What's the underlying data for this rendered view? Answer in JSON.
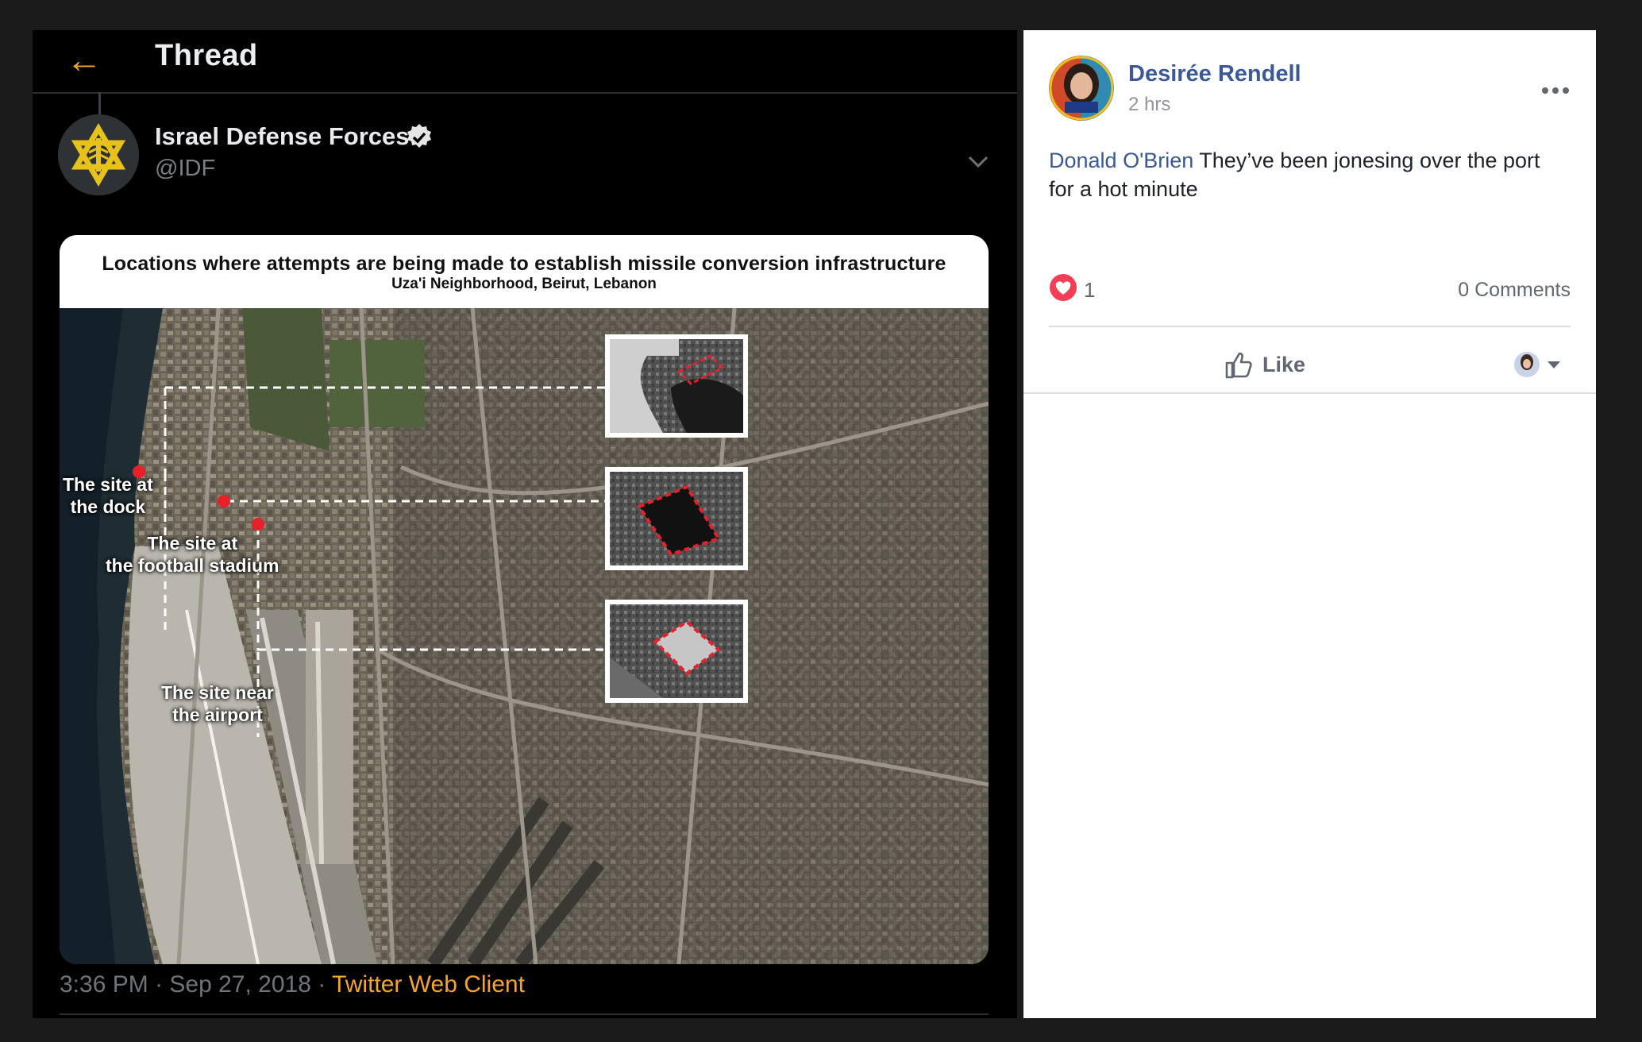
{
  "twitter": {
    "header": {
      "title": "Thread",
      "back_icon": "back-arrow-icon"
    },
    "tweet": {
      "author_name": "Israel Defense Forces",
      "handle": "@IDF",
      "verified": true,
      "media": {
        "title": "Locations where attempts are being made to establish missile conversion infrastructure",
        "subtitle": "Uza'i Neighborhood, Beirut, Lebanon",
        "labels": {
          "dock": "The site at\nthe dock",
          "stadium": "The site at\nthe football stadium",
          "airport": "The site near\nthe airport"
        }
      },
      "time": "3:36 PM",
      "separator": "·",
      "date": "Sep 27, 2018",
      "client": "Twitter Web Client"
    },
    "colors": {
      "accent": "#f4a52b",
      "background": "#000000"
    }
  },
  "facebook": {
    "post": {
      "author": "Desirée Rendell",
      "time": "2 hrs",
      "mention": "Donald O'Brien",
      "text": " They’ve been jonesing over the port for a hot minute",
      "reaction_count": "1",
      "comments": "0 Comments",
      "like_label": "Like"
    },
    "colors": {
      "link": "#3b5998",
      "love": "#f33e58"
    }
  }
}
